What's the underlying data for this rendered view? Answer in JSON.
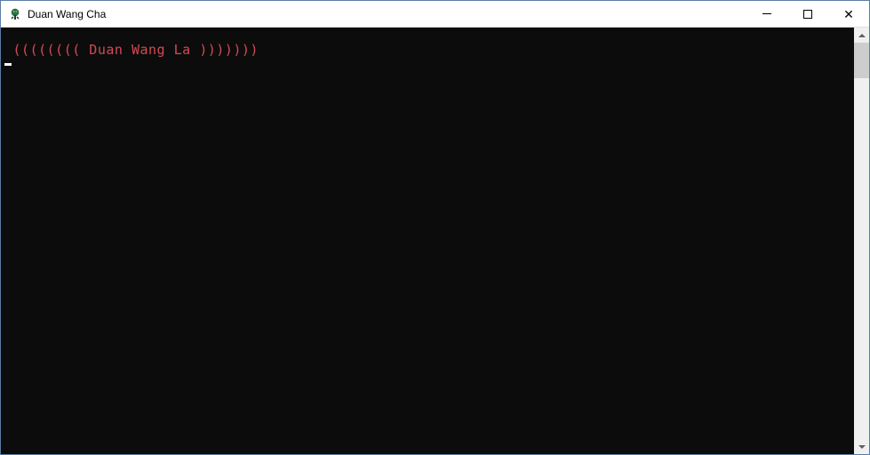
{
  "window": {
    "title": "Duan Wang Cha"
  },
  "console": {
    "line1": " (((((((( Duan Wang La )))))))"
  }
}
